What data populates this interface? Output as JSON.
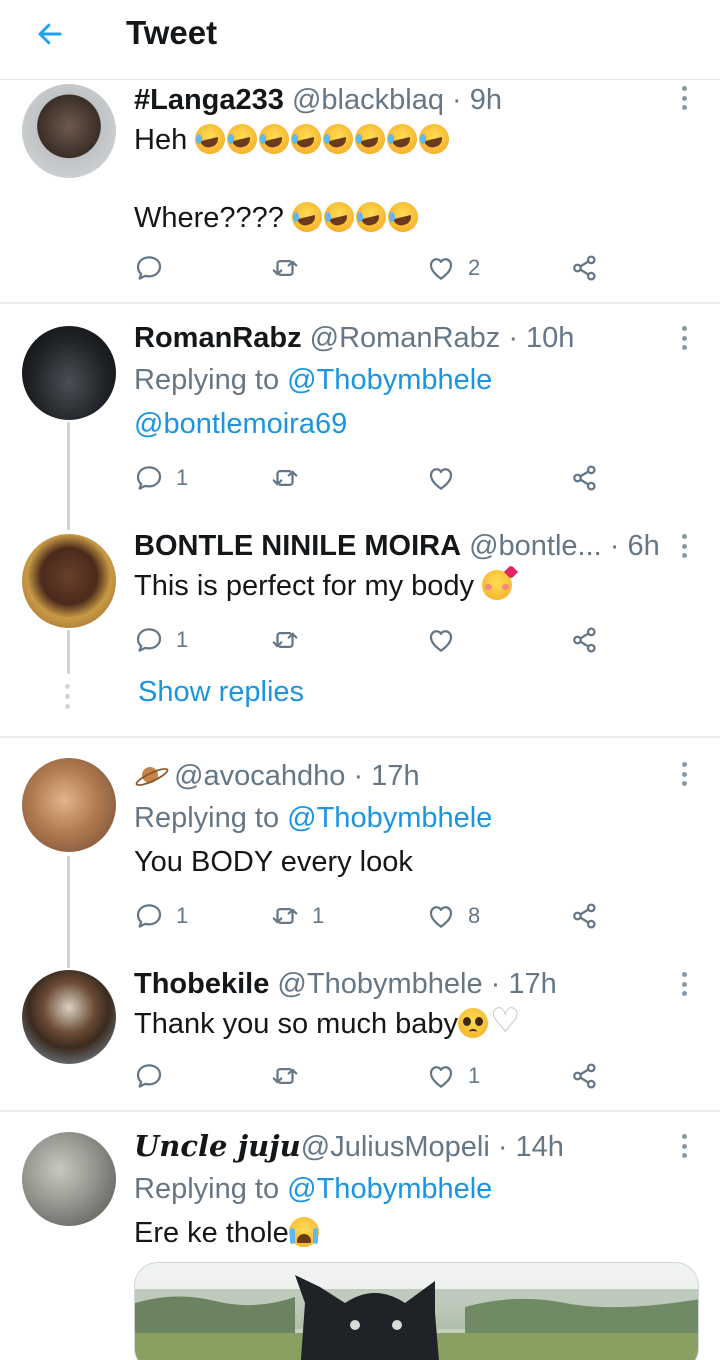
{
  "header": {
    "title": "Tweet"
  },
  "tweets": [
    {
      "name": "#Langa233",
      "handle": "@blackblaq",
      "time": "· 9h",
      "text1": "Heh",
      "text2": "Where????",
      "replies": "",
      "retweets": "",
      "likes": "2"
    },
    {
      "name": "RomanRabz",
      "handle": "@RomanRabz",
      "time": "· 10h",
      "replying_prefix": "Replying to",
      "replying_to": "@Thobymbhele",
      "mention2": "@bontlemoira69",
      "replies": "1",
      "retweets": "",
      "likes": ""
    },
    {
      "name": "BONTLE NINILE MOIRA",
      "handle": "@bontle...",
      "time": "· 6h",
      "text": "This is perfect for my body",
      "replies": "1",
      "retweets": "",
      "likes": "",
      "show_replies": "Show replies"
    },
    {
      "name": "",
      "handle": "@avocahdho",
      "time": "· 17h",
      "replying_prefix": "Replying to",
      "replying_to": "@Thobymbhele",
      "text": "You BODY every look",
      "replies": "1",
      "retweets": "1",
      "likes": "8"
    },
    {
      "name": "Thobekile",
      "handle": "@Thobymbhele",
      "time": "· 17h",
      "text": "Thank you so much baby",
      "replies": "",
      "retweets": "",
      "likes": "1"
    },
    {
      "name": "Uncle juju",
      "handle": "@JuliusMopeli",
      "time": "· 14h",
      "replying_prefix": "Replying to",
      "replying_to": "@Thobymbhele",
      "text": "Ere ke thole"
    }
  ],
  "colors": {
    "accent": "#1b95e0",
    "muted": "#657786",
    "divider": "#e6ecf0"
  },
  "icons": [
    "back-arrow-icon",
    "reply-icon",
    "retweet-icon",
    "like-icon",
    "share-icon",
    "more-icon"
  ]
}
